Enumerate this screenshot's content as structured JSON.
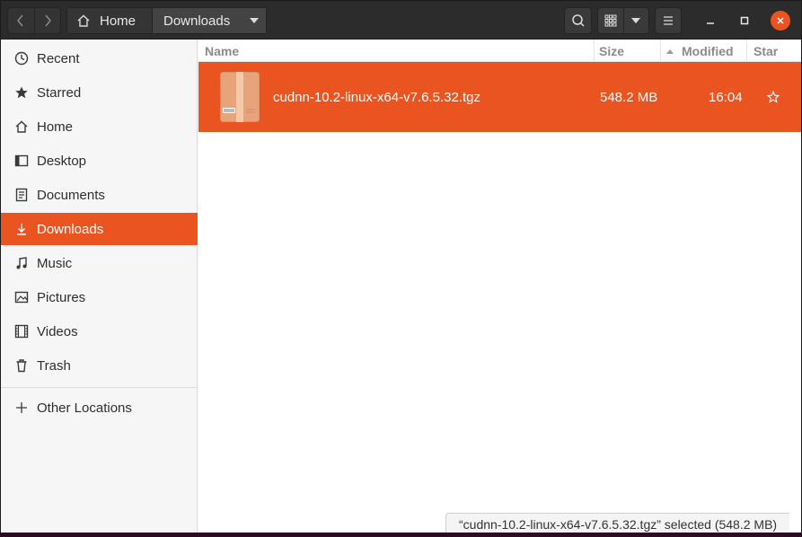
{
  "header": {
    "path": {
      "home_label": "Home",
      "current_label": "Downloads"
    }
  },
  "sidebar": {
    "items": [
      {
        "label": "Recent",
        "icon": "clock-icon"
      },
      {
        "label": "Starred",
        "icon": "star-icon"
      },
      {
        "label": "Home",
        "icon": "home-icon"
      },
      {
        "label": "Desktop",
        "icon": "desktop-icon"
      },
      {
        "label": "Documents",
        "icon": "document-icon"
      },
      {
        "label": "Downloads",
        "icon": "download-icon",
        "active": true
      },
      {
        "label": "Music",
        "icon": "music-icon"
      },
      {
        "label": "Pictures",
        "icon": "picture-icon"
      },
      {
        "label": "Videos",
        "icon": "video-icon"
      },
      {
        "label": "Trash",
        "icon": "trash-icon"
      }
    ],
    "other_locations": "Other Locations"
  },
  "file_list": {
    "columns": {
      "name": "Name",
      "size": "Size",
      "modified": "Modified",
      "star": "Star"
    },
    "rows": [
      {
        "name": "cudnn-10.2-linux-x64-v7.6.5.32.tgz",
        "size": "548.2 MB",
        "modified": "16:04",
        "starred": false,
        "selected": true
      }
    ]
  },
  "status": {
    "text": "“cudnn-10.2-linux-x64-v7.6.5.32.tgz” selected  (548.2 MB)"
  },
  "colors": {
    "accent": "#e95420",
    "headerbar": "#2c2c2c"
  }
}
